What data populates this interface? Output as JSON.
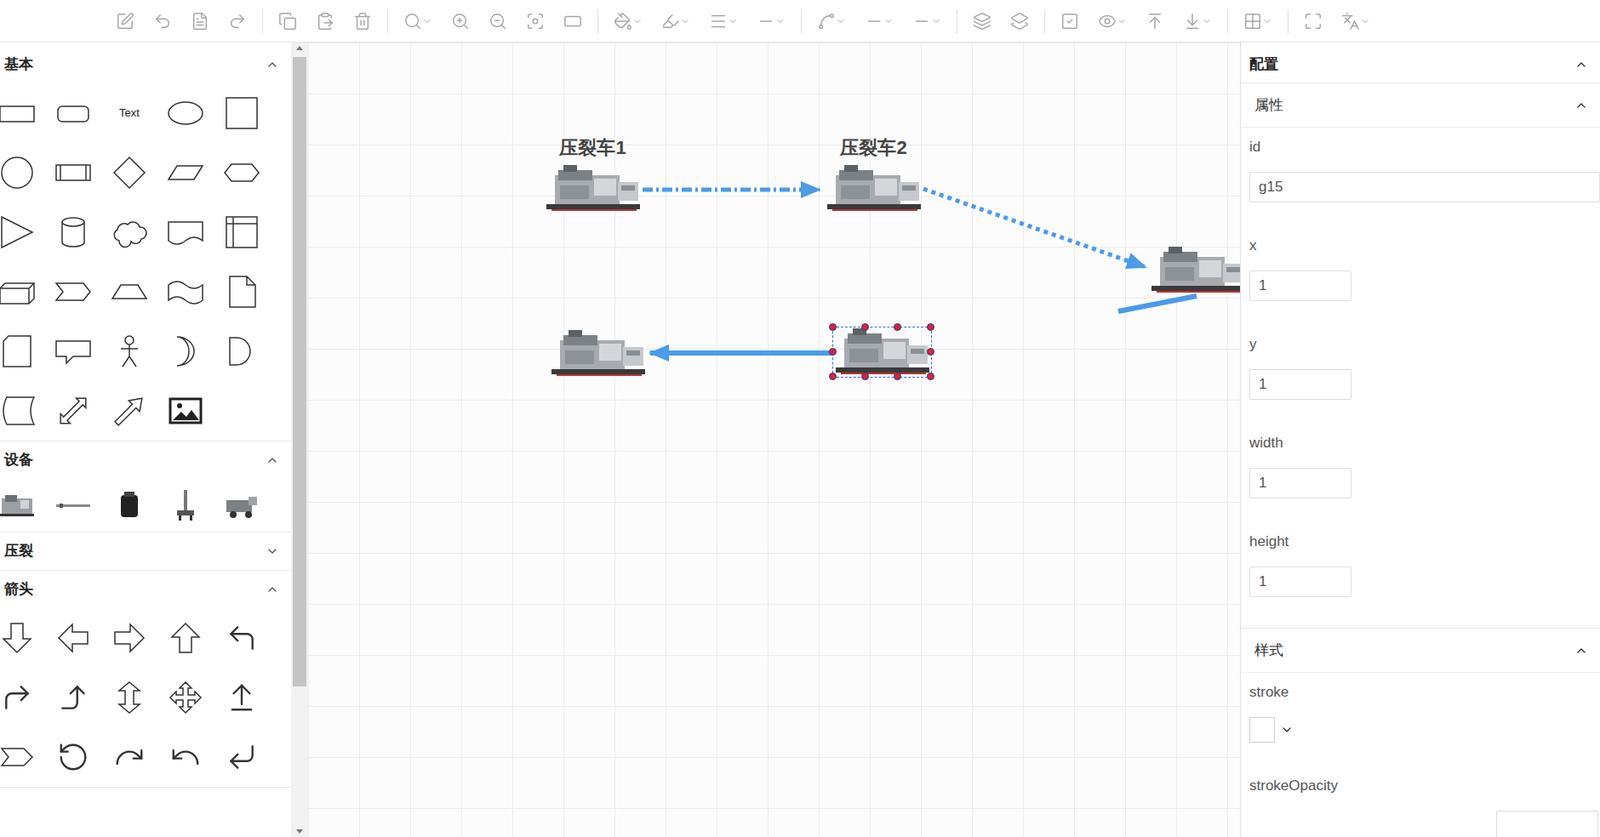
{
  "sidebar": {
    "sections": [
      {
        "title": "基本",
        "expanded": true,
        "kind": "shapes",
        "items": [
          {
            "kind": "rect"
          },
          {
            "kind": "rounded"
          },
          {
            "kind": "text",
            "label": "Text"
          },
          {
            "kind": "ellipse"
          },
          {
            "kind": "square"
          },
          {
            "kind": "circle"
          },
          {
            "kind": "process"
          },
          {
            "kind": "diamond"
          },
          {
            "kind": "parallelogram"
          },
          {
            "kind": "hexagon"
          },
          {
            "kind": "triangle"
          },
          {
            "kind": "cylinder"
          },
          {
            "kind": "cloud"
          },
          {
            "kind": "document"
          },
          {
            "kind": "internal"
          },
          {
            "kind": "cube"
          },
          {
            "kind": "step"
          },
          {
            "kind": "trapezoid"
          },
          {
            "kind": "tape"
          },
          {
            "kind": "note"
          },
          {
            "kind": "card"
          },
          {
            "kind": "callout"
          },
          {
            "kind": "actor"
          },
          {
            "kind": "or"
          },
          {
            "kind": "delay"
          },
          {
            "kind": "datastore"
          },
          {
            "kind": "doublearrow"
          },
          {
            "kind": "arrow"
          },
          {
            "kind": "image"
          }
        ]
      },
      {
        "title": "设备",
        "expanded": true,
        "kind": "devices",
        "items": [
          {
            "kind": "machine"
          },
          {
            "kind": "pipe"
          },
          {
            "kind": "tank"
          },
          {
            "kind": "rig"
          },
          {
            "kind": "truck"
          }
        ]
      },
      {
        "title": "压裂",
        "expanded": false,
        "kind": "shapes",
        "items": []
      },
      {
        "title": "箭头",
        "expanded": true,
        "kind": "arrows",
        "items": [
          {
            "kind": "down"
          },
          {
            "kind": "left"
          },
          {
            "kind": "right"
          },
          {
            "kind": "up"
          },
          {
            "kind": "uturn"
          },
          {
            "kind": "bendright"
          },
          {
            "kind": "stepup"
          },
          {
            "kind": "updown"
          },
          {
            "kind": "quad"
          },
          {
            "kind": "upnotch"
          },
          {
            "kind": "chevron"
          },
          {
            "kind": "curvedup"
          },
          {
            "kind": "curvedright"
          },
          {
            "kind": "curvedleft"
          },
          {
            "kind": "corner"
          }
        ]
      }
    ]
  },
  "canvas": {
    "nodes": [
      {
        "label": "压裂车1",
        "selected": false
      },
      {
        "label": "压裂车2",
        "selected": false
      },
      {
        "selected": false
      },
      {
        "selected": false
      },
      {
        "selected": true
      }
    ],
    "edges": [
      {
        "kind": "dashdot",
        "arrow": true
      },
      {
        "kind": "dotted",
        "arrow": true
      },
      {
        "kind": "solid",
        "arrow": true
      },
      {
        "kind": "solid",
        "arrow": false
      }
    ]
  },
  "panel": {
    "title": "配置",
    "expanded": true,
    "groups": [
      {
        "title": "属性",
        "expanded": true,
        "fields": [
          {
            "label": "id",
            "kind": "text",
            "value": "g15"
          },
          {
            "label": "x",
            "kind": "number",
            "value": "1"
          },
          {
            "label": "y",
            "kind": "number",
            "value": "1"
          },
          {
            "label": "width",
            "kind": "number",
            "value": "1"
          },
          {
            "label": "height",
            "kind": "number",
            "value": "1"
          }
        ]
      },
      {
        "title": "样式",
        "expanded": true,
        "fields": [
          {
            "label": "stroke",
            "kind": "color",
            "value": "#ffffff"
          },
          {
            "label": "strokeOpacity",
            "kind": "number",
            "value": ""
          }
        ]
      }
    ]
  }
}
